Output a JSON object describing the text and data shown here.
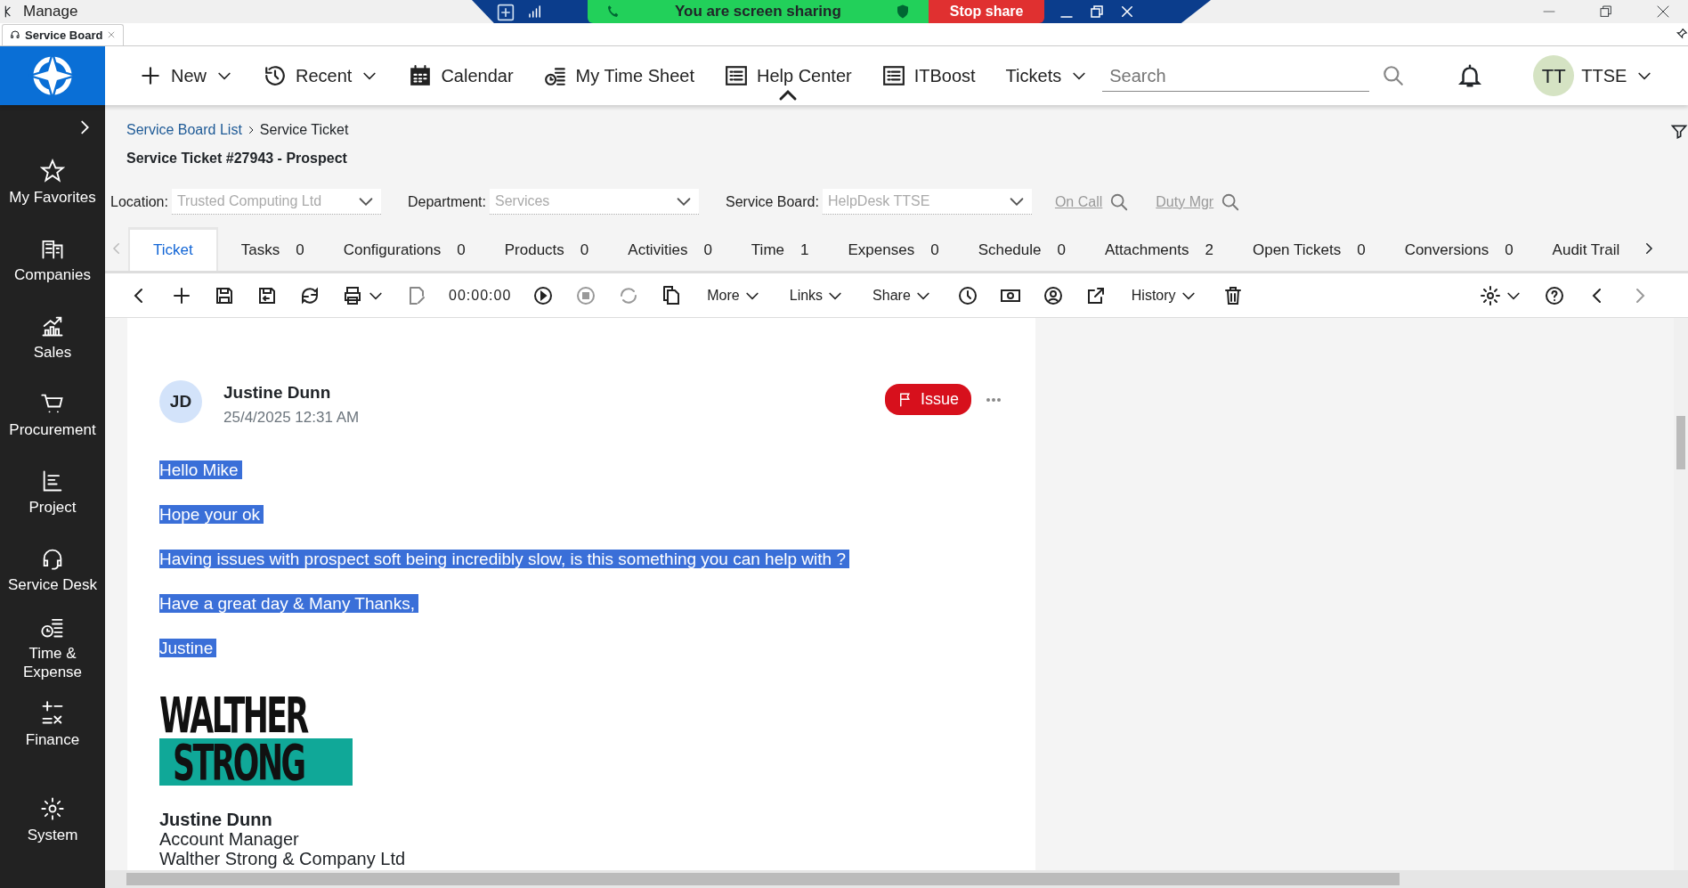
{
  "os_window": {
    "title": "Manage"
  },
  "share_bar": {
    "status": "You are screen sharing",
    "stop_label": "Stop share"
  },
  "browser_tab": {
    "label": "Service Board"
  },
  "navbar": {
    "items": [
      {
        "label": "New",
        "dropdown": true,
        "selected": false
      },
      {
        "label": "Recent",
        "dropdown": true,
        "selected": false
      },
      {
        "label": "Calendar",
        "dropdown": false,
        "selected": false
      },
      {
        "label": "My Time Sheet",
        "dropdown": false,
        "selected": false
      },
      {
        "label": "Help Center",
        "dropdown": false,
        "selected": true
      },
      {
        "label": "ITBoost",
        "dropdown": false,
        "selected": false
      },
      {
        "label": "Tickets",
        "dropdown": true,
        "selected": false
      }
    ],
    "search": {
      "placeholder": "Search"
    },
    "user": {
      "initials": "TT",
      "name": "TTSE"
    }
  },
  "sidebar": {
    "items": [
      {
        "label": "My Favorites"
      },
      {
        "label": "Companies"
      },
      {
        "label": "Sales"
      },
      {
        "label": "Procurement"
      },
      {
        "label": "Project"
      },
      {
        "label": "Service Desk"
      },
      {
        "label": "Time & Expense"
      },
      {
        "label": "Finance"
      },
      {
        "label": "System"
      }
    ]
  },
  "breadcrumb": [
    {
      "label": "Service Board List"
    },
    {
      "label": "Service Ticket"
    }
  ],
  "page_title": "Service Ticket #27943 - Prospect",
  "filters": [
    {
      "label": "Location:",
      "value": "Trusted Computing Ltd"
    },
    {
      "label": "Department:",
      "value": "Services"
    },
    {
      "label": "Service Board:",
      "value": "HelpDesk TTSE"
    }
  ],
  "lookup_links": [
    {
      "label": "On Call"
    },
    {
      "label": "Duty Mgr"
    }
  ],
  "tabs": [
    {
      "label": "Ticket",
      "selected": true
    },
    {
      "label": "Tasks",
      "count": "0",
      "selected": false
    },
    {
      "label": "Configurations",
      "count": "0",
      "selected": false
    },
    {
      "label": "Products",
      "count": "0",
      "selected": false
    },
    {
      "label": "Activities",
      "count": "0",
      "selected": false
    },
    {
      "label": "Time",
      "count": "1",
      "selected": false
    },
    {
      "label": "Expenses",
      "count": "0",
      "selected": false
    },
    {
      "label": "Schedule",
      "count": "0",
      "selected": false
    },
    {
      "label": "Attachments",
      "count": "2",
      "selected": false
    },
    {
      "label": "Open Tickets",
      "count": "0",
      "selected": false
    },
    {
      "label": "Conversions",
      "count": "0",
      "selected": false
    },
    {
      "label": "Audit Trail",
      "selected": false
    }
  ],
  "toolbar": {
    "timer": "00:00:00",
    "menus": [
      {
        "label": "More"
      },
      {
        "label": "Links"
      },
      {
        "label": "Share"
      }
    ],
    "history_label": "History"
  },
  "message": {
    "initials": "JD",
    "author": "Justine Dunn",
    "timestamp": "25/4/2025 12:31 AM",
    "tag": "Issue",
    "text_selected": true,
    "body": [
      "Hello Mike",
      "Hope your ok",
      "Having issues with prospect soft being incredibly slow, is this something you can help with ?",
      "Have a great day & Many Thanks,",
      "Justine"
    ],
    "logo_lines": [
      "WALTHER",
      "STRONG"
    ],
    "signature": {
      "name": "Justine Dunn",
      "role": "Account Manager",
      "company": "Walther Strong & Company Ltd"
    }
  }
}
